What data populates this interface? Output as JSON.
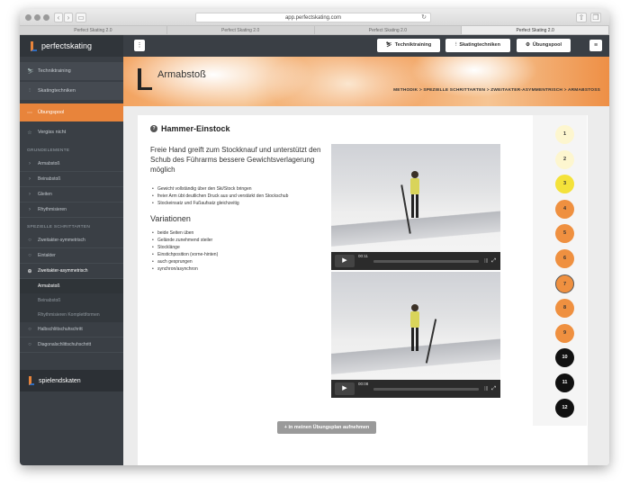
{
  "browser": {
    "url": "app.perfectskating.com",
    "tabs": [
      "Perfect Skating 2.0",
      "Perfect Skating 2.0",
      "Perfect Skating 2.0",
      "Perfect Skating 2.0"
    ],
    "active_tab": 3
  },
  "brand": {
    "name": "perfectskating",
    "footer": "spielendskaten"
  },
  "sidebar": {
    "main": [
      {
        "label": "Techniktraining",
        "icon": "skier-icon"
      },
      {
        "label": "Skatingtechniken",
        "icon": "pole-icon"
      },
      {
        "label": "Übungspool",
        "icon": "dots-icon",
        "active": true
      },
      {
        "label": "Vergiss nicht",
        "icon": "star-icon"
      }
    ],
    "section1": "GRUNDELEMENTE",
    "grund": [
      "Armabstoß",
      "Beinabstoß",
      "Gleiten",
      "Rhythmisieren"
    ],
    "section2": "SPEZIELLE SCHRITTARTEN",
    "spezial": [
      {
        "label": "Zweitakter-symmetrisch",
        "icon": "circle-icon"
      },
      {
        "label": "Eintakter",
        "icon": "circle-icon"
      },
      {
        "label": "Zweitakter-asymmetrisch",
        "icon": "circle-plus-icon",
        "open": true
      }
    ],
    "subitems": [
      "Armabstoß",
      "Beinabstoß",
      "Rhythmisieren Komplettformen"
    ],
    "more": [
      {
        "label": "Halbschlittschuhschritt",
        "icon": "circle-icon"
      },
      {
        "label": "Diagonalschlittschuhschritt",
        "icon": "circle-icon"
      }
    ]
  },
  "topbar": {
    "menu_glyph": "⋮",
    "buttons": [
      {
        "label": "Techniktraining",
        "icon": "skier-icon",
        "glyph": "⛷"
      },
      {
        "label": "Skatingtechniken",
        "icon": "pole-icon",
        "glyph": "⫶"
      },
      {
        "label": "Übungspool",
        "icon": "gears-icon",
        "glyph": "⚙"
      }
    ],
    "hamburger_glyph": "≡"
  },
  "hero": {
    "title": "Armabstoß",
    "breadcrumb": "METHODIK  >  SPEZIELLE SCHRITTARTEN  >  ZWEITAKTER-ASYMMENTRISCH  >  ARMABSTOSS"
  },
  "exercise": {
    "title": "Hammer-Einstock",
    "lead": "Freie Hand greift zum Stockknauf und unterstützt den Schub des Führarms bessere Gewichtsverlagerung möglich",
    "points": [
      "Gewicht vollständig über den Ski/Stock bringen",
      "freier Arm übt deutlichen Druck aus und verstärkt den Stockschub",
      "Stockeinsatz und Fußaufsatz gleichzeitig"
    ],
    "variations_title": "Variationen",
    "variations": [
      "beide Seiten üben",
      "Gelände zunehmend steiler",
      "Stocklänge",
      "Einstichposition (vorne-hinten)",
      "auch gesprungen",
      "synchron/asynchron"
    ],
    "videos": [
      {
        "time": "00:11"
      },
      {
        "time": "00:08"
      }
    ],
    "cta": "+ in meinen Übungsplan aufnehmen"
  },
  "levels": {
    "values": [
      "1",
      "2",
      "3",
      "4",
      "5",
      "6",
      "7",
      "8",
      "9",
      "10",
      "11",
      "12"
    ],
    "colors": [
      "#fdf6cf",
      "#fdf6cf",
      "#f4e23a",
      "#ef9040",
      "#ef9040",
      "#ef9040",
      "#ef9040",
      "#ef9040",
      "#ef9040",
      "#111111",
      "#111111",
      "#111111"
    ]
  }
}
